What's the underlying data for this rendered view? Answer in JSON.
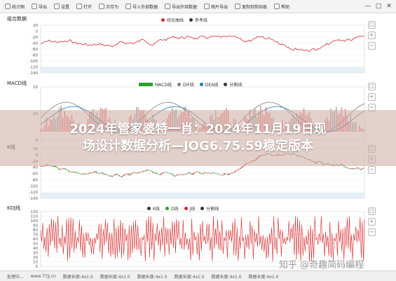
{
  "toolbar": {
    "items": [
      "统计图",
      "导出",
      "设置",
      "打开",
      "另存为",
      "导入外部数据",
      "导出外部数据",
      "图片导出",
      "复制到剪贴板",
      "帮助"
    ],
    "window_buttons": [
      "—",
      "□",
      "✕"
    ]
  },
  "panels": {
    "combo": {
      "title": "组合数据",
      "legend": [
        {
          "label": "综合曲线",
          "color": "#d62728"
        },
        {
          "label": "参考线",
          "color": "#333333"
        }
      ],
      "yticks": [
        "20",
        "0",
        "-20",
        "-40",
        "-60",
        "-80",
        "-100",
        "-120",
        "-140"
      ],
      "ylim": [
        -150,
        30
      ],
      "series_color": "#d62728"
    },
    "macd": {
      "title": "MACD线",
      "legend": [
        {
          "label": "MACD线",
          "color": "#2ca02c"
        },
        {
          "label": "DIF线",
          "color": "#7f7f7f"
        },
        {
          "label": "DEA线",
          "color": "#1f77b4"
        },
        {
          "label": "分割线",
          "color": "#333333"
        }
      ],
      "yticks": [
        "20",
        "10",
        "0"
      ],
      "ylim": [
        -5,
        25
      ]
    },
    "k": {
      "title": "K线",
      "yticks": [
        "20",
        "0",
        "-20",
        "-40",
        "-60",
        "-80",
        "-100",
        "-120",
        "-140"
      ],
      "ylim": [
        -150,
        30
      ],
      "up_color": "#d62728",
      "down_color": "#2ca02c"
    },
    "kdj": {
      "title": "KDJ线",
      "legend": [
        {
          "label": "K线",
          "color": "#333333"
        },
        {
          "label": "D线",
          "color": "#2ca02c"
        },
        {
          "label": "J线",
          "color": "#d62728"
        },
        {
          "label": "分割线",
          "color": "#333333"
        }
      ],
      "yticks": [
        "120",
        "110",
        "100",
        "90",
        "80",
        "70",
        "60",
        "50",
        "40",
        "30",
        "20",
        "10",
        "0"
      ],
      "ylim": [
        0,
        125
      ],
      "series_color": "#d62728"
    }
  },
  "side_buttons": [
    "□",
    "+",
    "−"
  ],
  "banner": {
    "line1": "2024年管家婆特一肖：2024年11月19日现",
    "line2": "场设计数据分析—JOG6.75.59稳定版本"
  },
  "statusbar": [
    "处理中...",
    "www.77jj.cn",
    "数据长度:4x1.0",
    "数据长度:4x1.0",
    "数据长度:4x1.0",
    "数据长度:4x1.0",
    "数据长度:4x1.0",
    "数据长度:4x1.0"
  ],
  "watermark": "知乎 @奇趣简码编程"
}
